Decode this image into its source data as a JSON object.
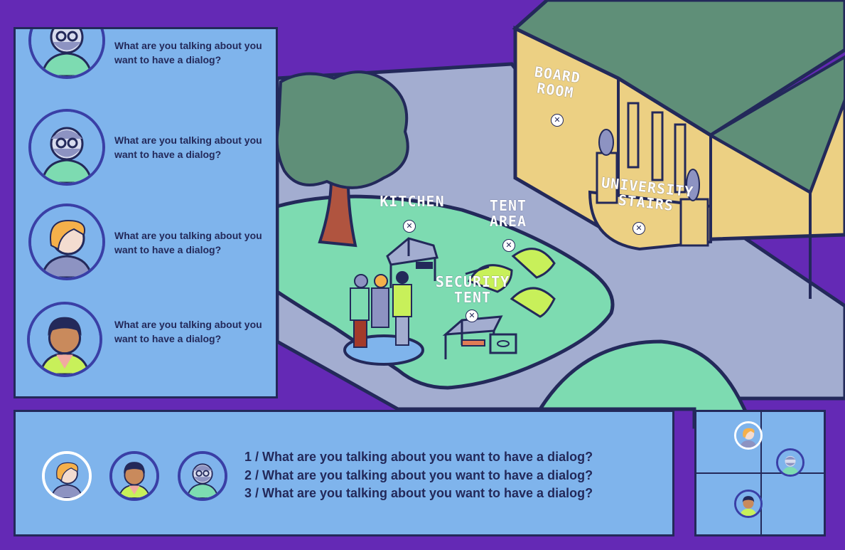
{
  "map": {
    "locations": [
      {
        "name": "Board Room"
      },
      {
        "name": "Kitchen"
      },
      {
        "name": "Tent Area"
      },
      {
        "name": "Security Tent"
      },
      {
        "name": "University Stairs"
      }
    ]
  },
  "dialog_log": {
    "entries": [
      {
        "character": "older-man",
        "text": "What are you talking about you want to have a dialog?"
      },
      {
        "character": "older-man",
        "text": "What are you talking about you want to have a dialog?"
      },
      {
        "character": "blonde-woman",
        "text": "What are you talking about you want to have a dialog?"
      },
      {
        "character": "security-guard",
        "text": "What are you talking about you want to have a dialog?"
      }
    ]
  },
  "choices": {
    "speakers": [
      "blonde-woman",
      "security-guard",
      "older-man"
    ],
    "active_speaker": "blonde-woman",
    "options": [
      "1 / What are you talking about you want to have a dialog?",
      "2 / What are you talking about you want to have a dialog?",
      "3 / What are you talking about you want to have a dialog?"
    ]
  },
  "minimap": {
    "characters": [
      "blonde-woman",
      "older-man",
      "security-guard"
    ],
    "active": "blonde-woman"
  },
  "colors": {
    "background": "#6429b5",
    "panel": "#7fb4ec",
    "outline": "#23295a",
    "grass": "#7ddbb1",
    "road": "#a3add0",
    "building": "#ecd083",
    "roof": "#5f8f78",
    "tent": "#c8f05a"
  }
}
